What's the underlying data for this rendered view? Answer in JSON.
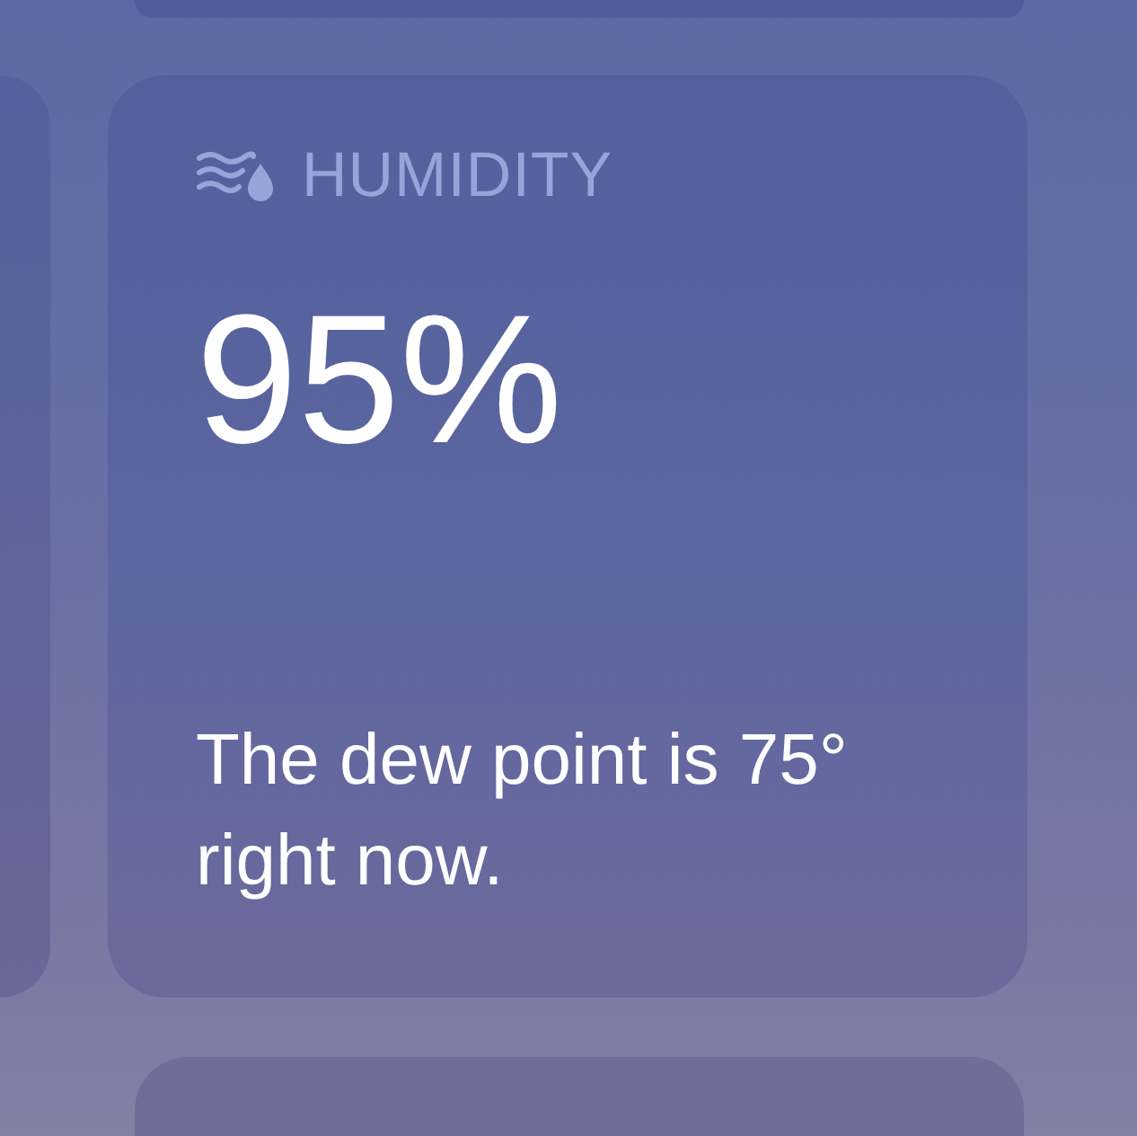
{
  "widget": {
    "title": "HUMIDITY",
    "value": "95%",
    "description": "The dew point is 75° right now."
  }
}
